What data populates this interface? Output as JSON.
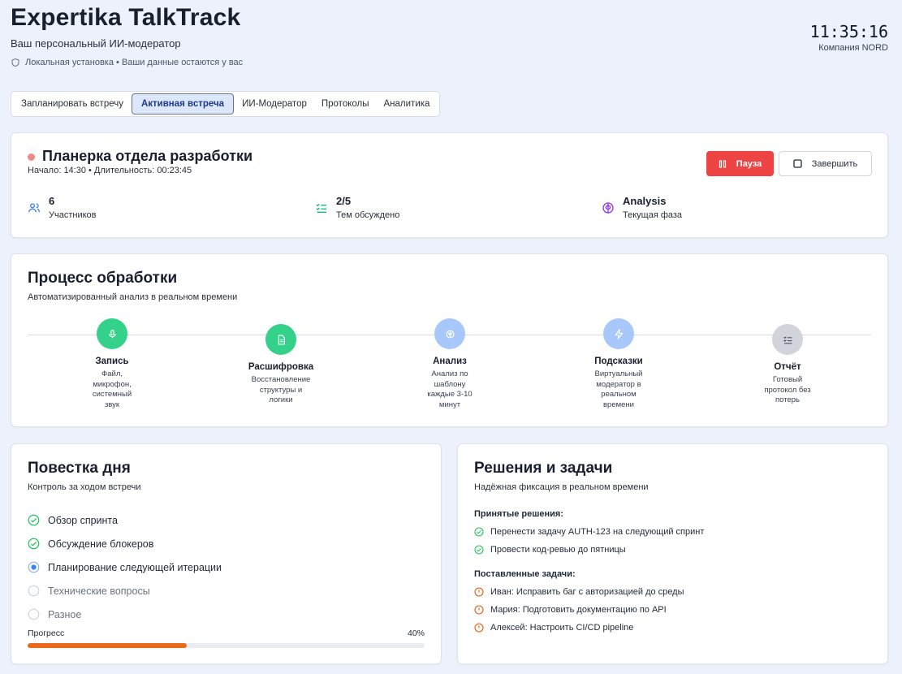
{
  "app": {
    "title": "Expertika TalkTrack",
    "subtitle": "Ваш персональный ИИ-модератор",
    "local_note": "Локальная установка • Ваши данные остаются у вас",
    "clock": "11:35:16",
    "company": "Компания NORD"
  },
  "tabs": [
    {
      "label": "Запланировать встречу",
      "active": false
    },
    {
      "label": "Активная встреча",
      "active": true
    },
    {
      "label": "ИИ-Модератор",
      "active": false
    },
    {
      "label": "Протоколы",
      "active": false
    },
    {
      "label": "Аналитика",
      "active": false
    }
  ],
  "meeting": {
    "title": "Планерка отдела разработки",
    "meta": "Начало: 14:30 • Длительность: 00:23:45",
    "pause_label": "Пауза",
    "finish_label": "Завершить",
    "stats": [
      {
        "value": "6",
        "label": "Участников",
        "icon": "users-icon"
      },
      {
        "value": "2/5",
        "label": "Тем обсуждено",
        "icon": "checklist-icon"
      },
      {
        "value": "Analysis",
        "label": "Текущая фаза",
        "icon": "brain-icon"
      }
    ]
  },
  "pipeline": {
    "title": "Процесс обработки",
    "subtitle": "Автоматизированный анализ в реальном времени",
    "steps": [
      {
        "name": "Запись",
        "desc": "Файл, микрофон, системный звук",
        "status": "done",
        "icon": "microphone-icon"
      },
      {
        "name": "Расшифровка",
        "desc": "Восстановление структуры и логики",
        "status": "done",
        "icon": "document-icon"
      },
      {
        "name": "Анализ",
        "desc": "Анализ по шаблону каждые 3-10 минут",
        "status": "active",
        "icon": "brain-icon"
      },
      {
        "name": "Подсказки",
        "desc": "Виртуальный модератор в реальном времени",
        "status": "active",
        "icon": "lightning-icon"
      },
      {
        "name": "Отчёт",
        "desc": "Готовый протокол без потерь",
        "status": "pending",
        "icon": "checklist-icon"
      }
    ]
  },
  "agenda": {
    "title": "Повестка дня",
    "subtitle": "Контроль за ходом встречи",
    "items": [
      {
        "label": "Обзор спринта",
        "status": "done"
      },
      {
        "label": "Обсуждение блокеров",
        "status": "done"
      },
      {
        "label": "Планирование следующей итерации",
        "status": "current"
      },
      {
        "label": "Технические вопросы",
        "status": "pending"
      },
      {
        "label": "Разное",
        "status": "pending"
      }
    ],
    "progress_label": "Прогресс",
    "progress_value": "40%",
    "progress_fraction": 0.4
  },
  "decisions": {
    "title": "Решения и задачи",
    "subtitle": "Надёжная фиксация в реальном времени",
    "decisions_title": "Принятые решения:",
    "decisions": [
      "Перенести задачу AUTH-123 на следующий спринт",
      "Провести код-ревью до пятницы"
    ],
    "tasks_title": "Поставленные задачи:",
    "tasks": [
      "Иван: Исправить баг с авторизацией до среды",
      "Мария: Подготовить документацию по API",
      "Алексей: Настроить CI/CD pipeline"
    ]
  },
  "colors": {
    "green": "#22c55e",
    "step_done": "#34d18a",
    "step_active": "#a8c8fb",
    "step_pending": "#d1d5db",
    "pause": "#ef4444",
    "progress": "#ea6a1c",
    "task_icon": "#ea580c",
    "current_blue": "#3b82f6"
  }
}
